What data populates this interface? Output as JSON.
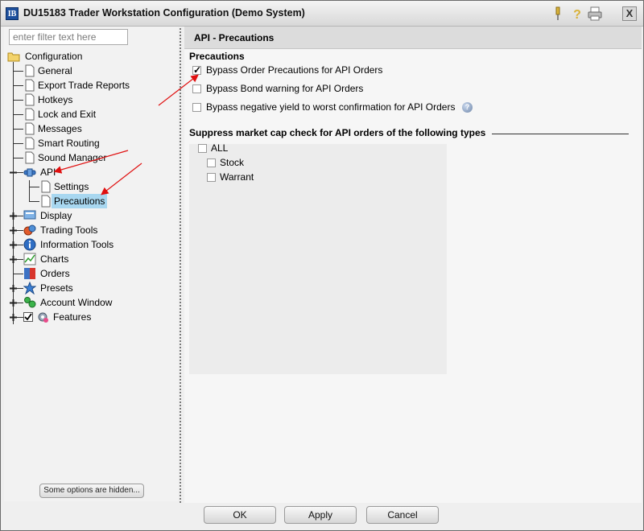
{
  "window": {
    "app_icon_text": "IB",
    "title": "DU15183 Trader Workstation Configuration (Demo System)",
    "close_label": "X"
  },
  "filter": {
    "placeholder": "enter filter text here"
  },
  "tree": {
    "root": "Configuration",
    "items": [
      {
        "label": "General"
      },
      {
        "label": "Export Trade Reports"
      },
      {
        "label": "Hotkeys"
      },
      {
        "label": "Lock and Exit"
      },
      {
        "label": "Messages"
      },
      {
        "label": "Smart Routing"
      },
      {
        "label": "Sound Manager"
      },
      {
        "label": "API"
      },
      {
        "label": "Settings"
      },
      {
        "label": "Precautions"
      },
      {
        "label": "Display"
      },
      {
        "label": "Trading Tools"
      },
      {
        "label": "Information Tools"
      },
      {
        "label": "Charts"
      },
      {
        "label": "Orders"
      },
      {
        "label": "Presets"
      },
      {
        "label": "Account Window"
      },
      {
        "label": "Features"
      }
    ]
  },
  "hidden_notice": "Some options are hidden...",
  "panel": {
    "header": "API - Precautions",
    "precautions": {
      "title": "Precautions",
      "options": [
        {
          "label": "Bypass Order Precautions for API Orders",
          "checked": true
        },
        {
          "label": "Bypass Bond warning for API Orders",
          "checked": false
        },
        {
          "label": "Bypass negative yield to worst confirmation for API Orders",
          "checked": false
        }
      ]
    },
    "suppress": {
      "title": "Suppress market cap check for API orders of the following types",
      "options": [
        {
          "label": "ALL",
          "checked": false
        },
        {
          "label": "Stock",
          "checked": false
        },
        {
          "label": "Warrant",
          "checked": false
        }
      ]
    }
  },
  "buttons": {
    "ok": "OK",
    "apply": "Apply",
    "cancel": "Cancel"
  },
  "colors": {
    "selection": "#a8d7f0",
    "annotation_arrow": "#e01010"
  }
}
